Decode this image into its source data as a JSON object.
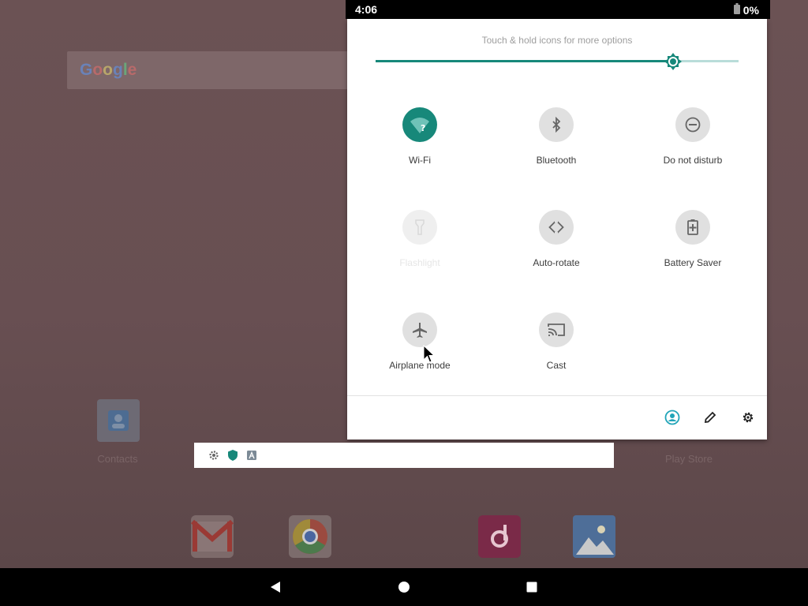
{
  "status_bar": {
    "time": "4:06",
    "battery_percent": "0%"
  },
  "launcher": {
    "search_logo": "Google",
    "apps": [
      {
        "name": "Contacts"
      },
      {
        "name": "Play Store"
      }
    ],
    "dock": [
      "gmail-icon",
      "chrome-icon",
      "music-icon",
      "photos-icon"
    ]
  },
  "quick_settings": {
    "hint": "Touch & hold icons for more options",
    "brightness_level": 0.82,
    "tiles": [
      {
        "label": "Wi-Fi",
        "icon": "wifi-icon",
        "state": "on"
      },
      {
        "label": "Bluetooth",
        "icon": "bluetooth-icon",
        "state": "off"
      },
      {
        "label": "Do not disturb",
        "icon": "do-not-disturb-icon",
        "state": "off"
      },
      {
        "label": "Flashlight",
        "icon": "flashlight-icon",
        "state": "unavailable"
      },
      {
        "label": "Auto-rotate",
        "icon": "auto-rotate-icon",
        "state": "off"
      },
      {
        "label": "Battery Saver",
        "icon": "battery-saver-icon",
        "state": "off"
      },
      {
        "label": "Airplane mode",
        "icon": "airplane-icon",
        "state": "off"
      },
      {
        "label": "Cast",
        "icon": "cast-icon",
        "state": "off"
      }
    ],
    "footer": [
      "user-icon",
      "edit-icon",
      "settings-icon"
    ]
  },
  "notification_strip": [
    "settings-icon",
    "shield-icon",
    "app-icon"
  ],
  "colors": {
    "accent": "#17887a",
    "user_accent": "#20a4b8",
    "tile_off": "#e0e0e0"
  }
}
